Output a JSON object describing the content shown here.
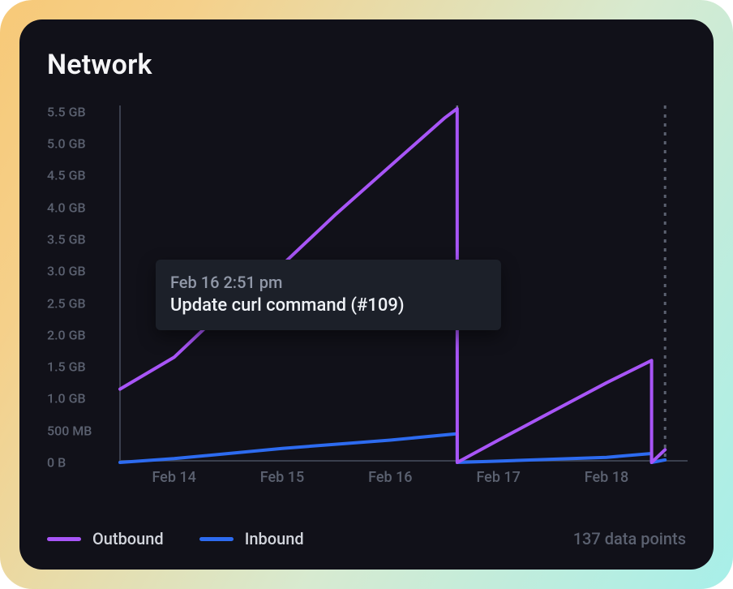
{
  "title": "Network",
  "y_ticks": [
    "5.5 GB",
    "5.0 GB",
    "4.5 GB",
    "4.0 GB",
    "3.5 GB",
    "3.0 GB",
    "2.5 GB",
    "2.0 GB",
    "1.5 GB",
    "1.0 GB",
    "500 MB",
    "0 B"
  ],
  "x_ticks": [
    "Feb 14",
    "Feb 15",
    "Feb 16",
    "Feb 17",
    "Feb 18"
  ],
  "legend": {
    "outbound": "Outbound",
    "inbound": "Inbound"
  },
  "data_points_label": "137 data points",
  "tooltip": {
    "time": "Feb 16 2:51 pm",
    "title": "Update curl command (#109)"
  },
  "colors": {
    "outbound": "#a855f7",
    "inbound": "#2d6bf0",
    "axis": "#3a3f4d",
    "muted": "#5b6170",
    "bg": "#111119",
    "tooltip_bg": "#1c2029"
  },
  "chart_data": {
    "type": "line",
    "title": "Network",
    "xlabel": "",
    "ylabel": "",
    "ylim_gb": [
      0,
      5.6
    ],
    "x_range": [
      "Feb 13 12:00",
      "Feb 18 18:00"
    ],
    "x_tick_labels": [
      "Feb 14",
      "Feb 15",
      "Feb 16",
      "Feb 17",
      "Feb 18"
    ],
    "y_tick_labels": [
      "0 B",
      "500 MB",
      "1.0 GB",
      "1.5 GB",
      "2.0 GB",
      "2.5 GB",
      "3.0 GB",
      "3.5 GB",
      "4.0 GB",
      "4.5 GB",
      "5.0 GB",
      "5.5 GB"
    ],
    "event_marker": {
      "x": "Feb 16 14:51",
      "label": "Update curl command (#109)"
    },
    "now_marker": {
      "x": "Feb 18 13:00"
    },
    "series": [
      {
        "name": "Outbound",
        "color": "#a855f7",
        "unit": "GB",
        "points": [
          {
            "x": "Feb 13 12:00",
            "y": 1.15
          },
          {
            "x": "Feb 14 00:00",
            "y": 1.65
          },
          {
            "x": "Feb 14 12:00",
            "y": 2.45
          },
          {
            "x": "Feb 15 00:00",
            "y": 3.1
          },
          {
            "x": "Feb 15 12:00",
            "y": 3.9
          },
          {
            "x": "Feb 16 00:00",
            "y": 4.65
          },
          {
            "x": "Feb 16 12:00",
            "y": 5.4
          },
          {
            "x": "Feb 16 14:51",
            "y": 5.55
          },
          {
            "x": "Feb 16 14:52",
            "y": 0.0
          },
          {
            "x": "Feb 17 00:00",
            "y": 0.35
          },
          {
            "x": "Feb 17 12:00",
            "y": 0.8
          },
          {
            "x": "Feb 18 00:00",
            "y": 1.25
          },
          {
            "x": "Feb 18 10:00",
            "y": 1.6
          },
          {
            "x": "Feb 18 10:01",
            "y": 0.0
          },
          {
            "x": "Feb 18 13:00",
            "y": 0.2
          }
        ]
      },
      {
        "name": "Inbound",
        "color": "#2d6bf0",
        "unit": "GB",
        "points": [
          {
            "x": "Feb 13 12:00",
            "y": 0.0
          },
          {
            "x": "Feb 14 00:00",
            "y": 0.06
          },
          {
            "x": "Feb 15 00:00",
            "y": 0.22
          },
          {
            "x": "Feb 16 00:00",
            "y": 0.35
          },
          {
            "x": "Feb 16 14:51",
            "y": 0.45
          },
          {
            "x": "Feb 16 14:52",
            "y": 0.0
          },
          {
            "x": "Feb 17 00:00",
            "y": 0.02
          },
          {
            "x": "Feb 18 00:00",
            "y": 0.08
          },
          {
            "x": "Feb 18 10:00",
            "y": 0.14
          },
          {
            "x": "Feb 18 10:01",
            "y": 0.0
          },
          {
            "x": "Feb 18 13:00",
            "y": 0.04
          }
        ]
      }
    ]
  }
}
